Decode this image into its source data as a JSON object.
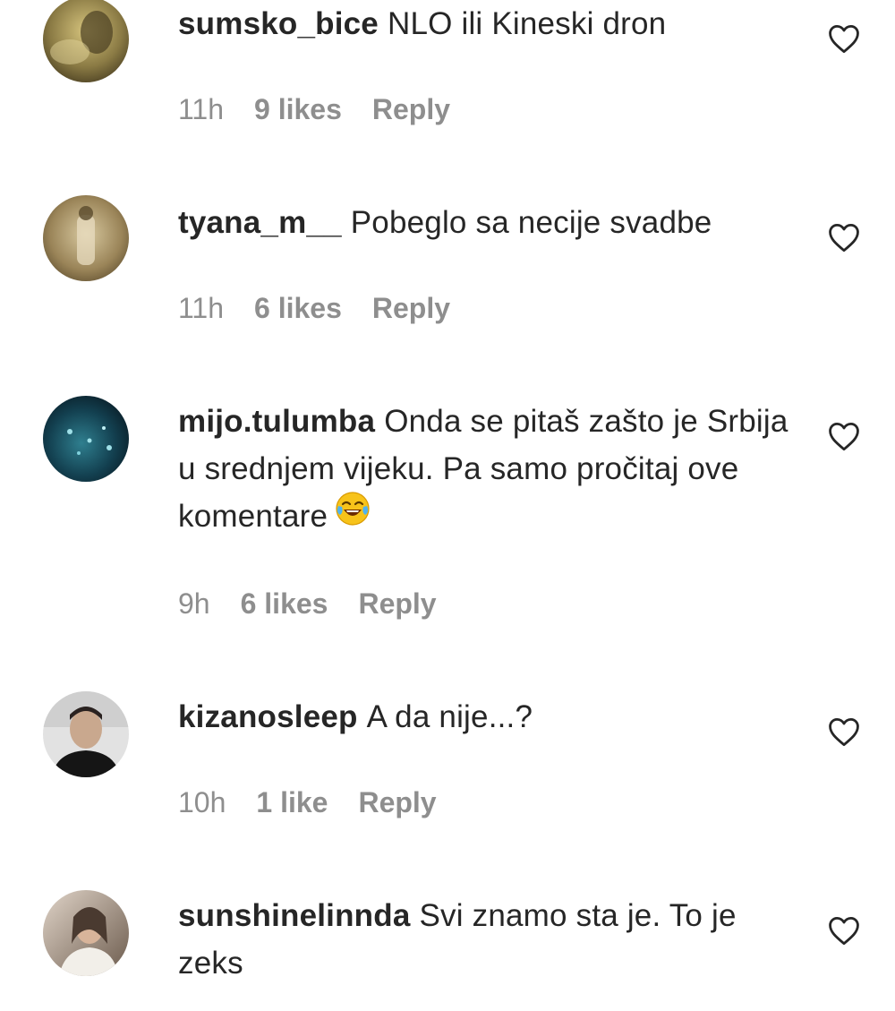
{
  "comments": [
    {
      "username": "sumsko_bice",
      "text": "NLO ili Kineski dron",
      "time": "11h",
      "likes": "9 likes",
      "reply": "Reply",
      "avatar_colors": [
        "#b8a461",
        "#5b4d2a"
      ]
    },
    {
      "username": "tyana_m__",
      "text": "Pobeglo sa necije svadbe",
      "time": "11h",
      "likes": "6 likes",
      "reply": "Reply",
      "avatar_colors": [
        "#c9b98a",
        "#6e5c39"
      ]
    },
    {
      "username": "mijo.tulumba",
      "text": "Onda se pitaš zašto je Srbija u srednjem vijeku. Pa samo pročitaj ove komentare",
      "emoji": "face-with-tears-of-joy",
      "time": "9h",
      "likes": "6 likes",
      "reply": "Reply",
      "avatar_colors": [
        "#1f5a6a",
        "#0b1f2c"
      ]
    },
    {
      "username": "kizanosleep",
      "text": "A da nije...?",
      "time": "10h",
      "likes": "1 like",
      "reply": "Reply",
      "avatar_colors": [
        "#d9d9d9",
        "#1a1a1a"
      ]
    },
    {
      "username": "sunshinelinnda",
      "text": "Svi znamo sta je. To je zeks",
      "time": "",
      "likes": "",
      "reply": "",
      "avatar_colors": [
        "#c8b8a8",
        "#5a4a3e"
      ]
    }
  ],
  "icons": {
    "like": "heart-outline-icon"
  },
  "colors": {
    "text": "#262626",
    "meta": "#8e8e8e"
  }
}
